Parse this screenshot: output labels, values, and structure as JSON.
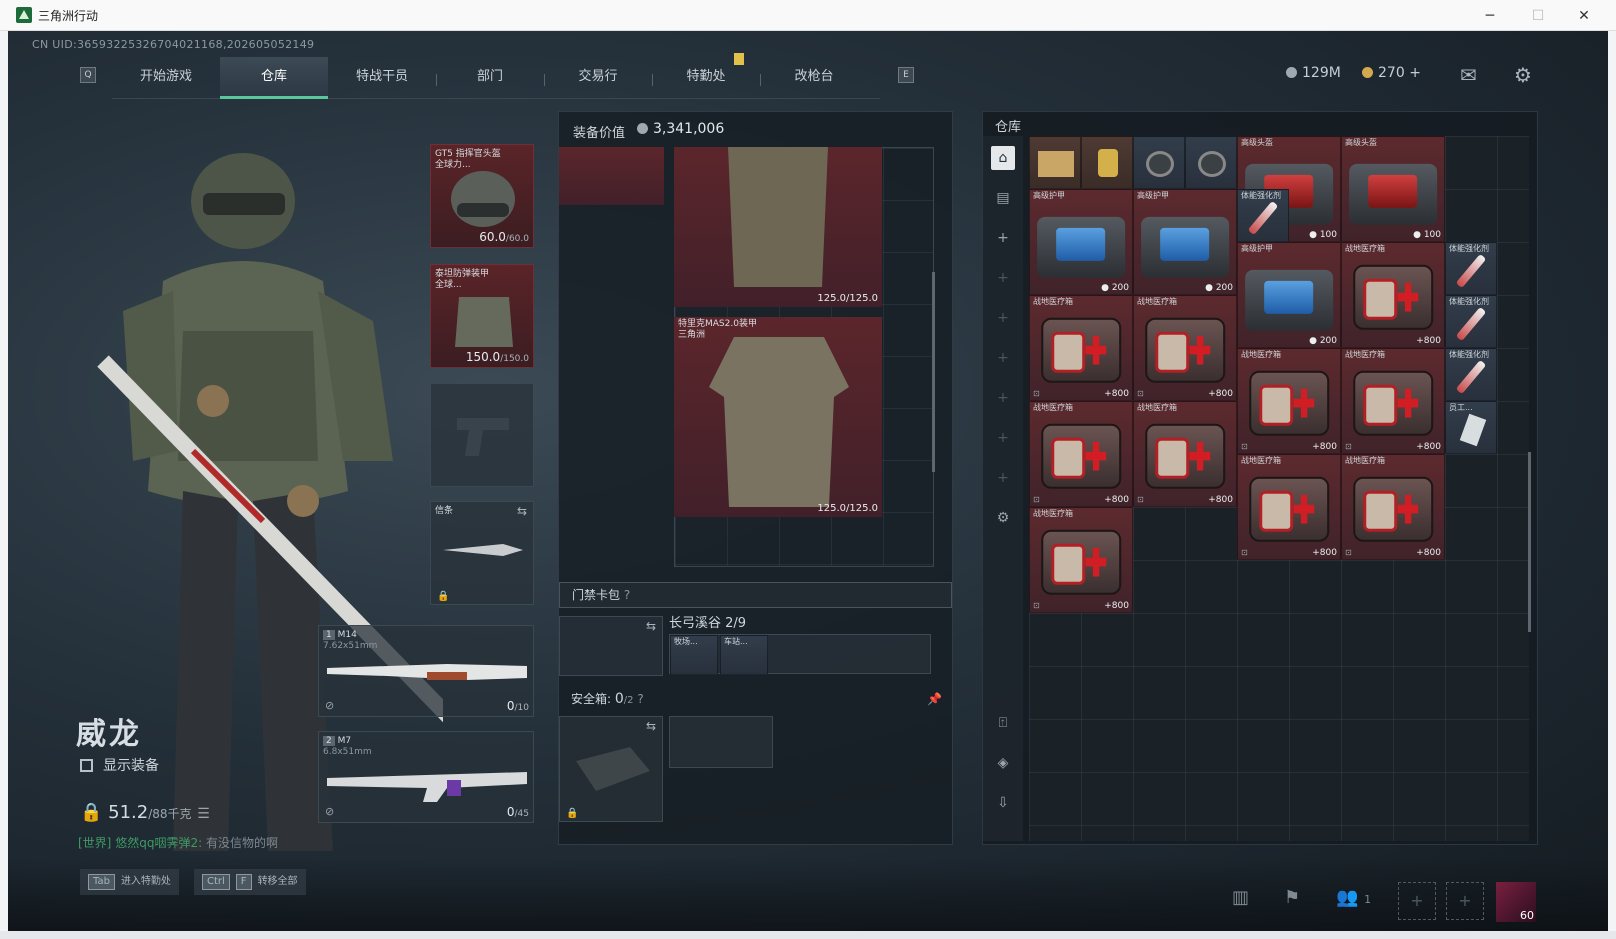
{
  "window": {
    "title": "三角洲行动",
    "minimize": "─",
    "maximize": "☐",
    "close": "✕"
  },
  "uid": "CN UID:365932253267040211​68,202605052149",
  "nav": {
    "left_key": "Q",
    "right_key": "E",
    "tabs": [
      "开始游戏",
      "仓库",
      "特战干员",
      "部门",
      "交易行",
      "特勤处",
      "改枪台"
    ],
    "active": "仓库"
  },
  "currency": {
    "silver": "129M",
    "gold": "270",
    "add": "+"
  },
  "operator": {
    "name": "威龙",
    "show_gear": "显示装备",
    "weight": "51.2",
    "weight_max": "/88千克"
  },
  "chat": {
    "channel": "[世界]",
    "user": "悠然qq咽霁弹2:",
    "text": "有没信物的啊"
  },
  "equipment": {
    "helmet": {
      "label": "GT5 指挥官头盔\n全球力...",
      "durability": "60.0",
      "max": "/60.0"
    },
    "armor": {
      "label": "泰坦防弹装甲\n全球...",
      "durability": "150.0",
      "max": "/150.0"
    },
    "melee": {
      "label": "信条"
    },
    "primary": {
      "num": "1",
      "name": "M14",
      "caliber": "7.62x51mm",
      "ammo": "0",
      "ammo_max": "/10"
    },
    "secondary": {
      "num": "2",
      "name": "M7",
      "caliber": "6.8x51mm",
      "ammo": "0",
      "ammo_max": "/45"
    }
  },
  "mid": {
    "header": "装备价值",
    "value": "3,341,006",
    "armor1_val": "125.0/125.0",
    "armor2_label": "特里克MAS2.0装甲\n三角洲",
    "armor2_val": "125.0/125.0",
    "keycard": "门禁卡包",
    "keycard_q": "?",
    "map_name": "长弓溪谷",
    "map_count": "2/9",
    "key_labels": [
      "牧场...",
      "车站..."
    ],
    "safebox": "安全箱:",
    "safebox_count": "0",
    "safebox_max": "/2",
    "safebox_q": "?"
  },
  "stash": {
    "title": "仓库",
    "labels": {
      "armor": "高级护甲",
      "helmet": "高级头盔",
      "medkit": "战地医疗箱",
      "syringe": "体能强化剂",
      "tag": "员工..."
    },
    "quantities": {
      "medkit": "+800",
      "case200": "200",
      "case100": "100"
    }
  },
  "hints": [
    {
      "key": "Tab",
      "text": "进入特勤处"
    },
    {
      "key": "Ctrl",
      "key2": "F",
      "text": "转移全部"
    }
  ],
  "bottom": {
    "friends": "1",
    "level": "60"
  }
}
